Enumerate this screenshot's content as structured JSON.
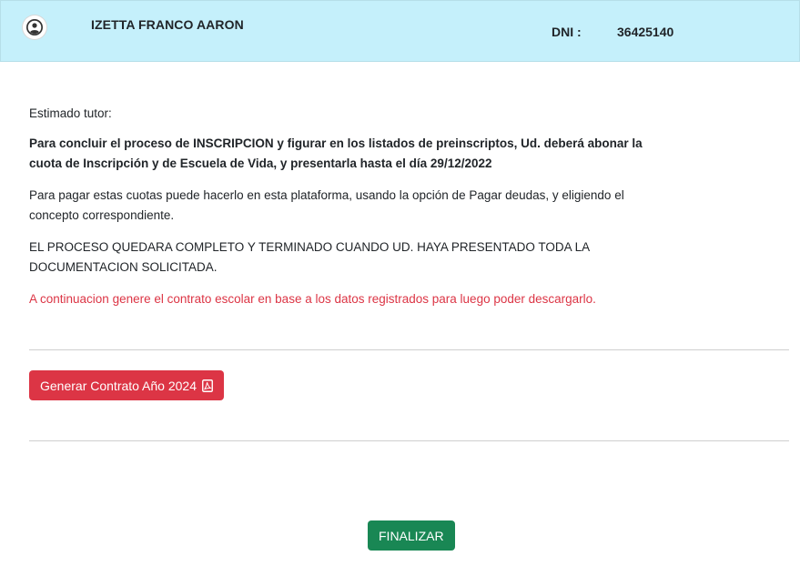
{
  "header": {
    "avatar_icon": "user-circle-icon",
    "user_name": "IZETTA FRANCO AARON",
    "dni_label": "DNI :",
    "dni_value": "36425140",
    "background_color": "#c5f0fb"
  },
  "message": {
    "greeting": "Estimado tutor:",
    "bold_notice": "Para concluir el proceso de INSCRIPCION y figurar en los listados de preinscriptos, Ud. deberá abonar la cuota de Inscripción y de Escuela de Vida, y presentarla hasta el día 29/12/2022",
    "payment_info": "Para pagar estas cuotas puede hacerlo en esta plataforma, usando la opción de Pagar deudas, y eligiendo el concepto correspondiente.",
    "process_notice": "EL PROCESO QUEDARA COMPLETO Y TERMINADO CUANDO UD. HAYA PRESENTADO TODA LA DOCUMENTACION SOLICITADA.",
    "red_notice": "A continuacion genere el contrato escolar en base a los datos registrados para luego poder descargarlo.",
    "red_color": "#dc3545"
  },
  "actions": {
    "generate_contract_label": "Generar Contrato Año 2024",
    "generate_contract_icon": "pdf-file-icon",
    "generate_contract_color": "#dc3545",
    "finish_label": "FINALIZAR",
    "finish_color": "#198754"
  }
}
